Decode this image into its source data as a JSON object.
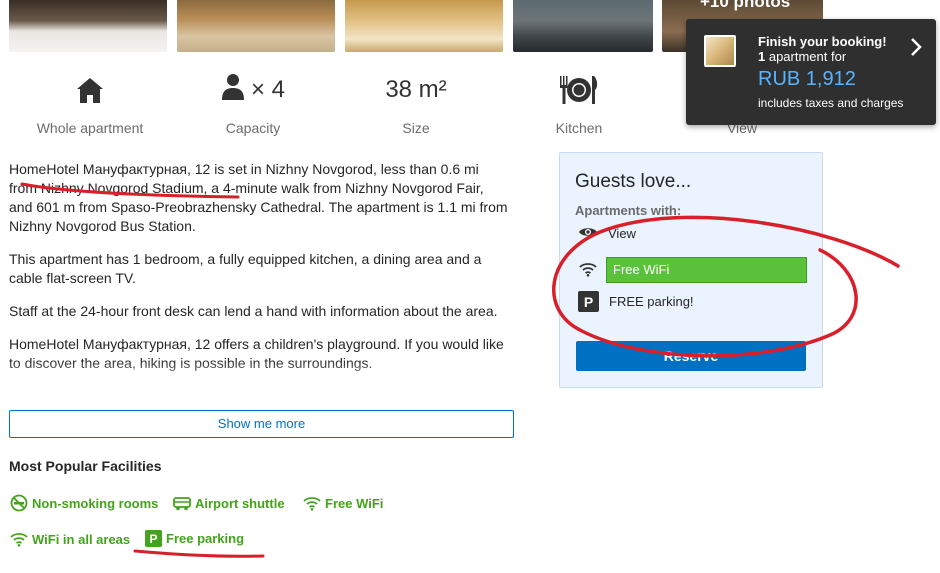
{
  "photos": {
    "more_label": "+10 photos"
  },
  "features": [
    {
      "icon": "house-icon",
      "label": "Whole apartment"
    },
    {
      "icon": "person-icon",
      "value": "× 4",
      "label": "Capacity"
    },
    {
      "value": "38 m²",
      "label": "Size"
    },
    {
      "icon": "fork-plate-knife-icon",
      "label": "Kitchen"
    },
    {
      "icon": "eye-icon",
      "label": "View"
    }
  ],
  "description": [
    "HomeHotel Мануфактурная, 12 is set in Nizhny Novgorod, less than 0.6 mi from Nizhny Novgorod Stadium, a 4-minute walk from Nizhny Novgorod Fair, and 601 m from Spaso-Preobrazhensky Cathedral. The apartment is 1.1 mi from Nizhny Novgorod Bus Station.",
    "This apartment has 1 bedroom, a fully equipped kitchen, a dining area and a cable flat-screen TV.",
    "Staff at the 24-hour front desk can lend a hand with information about the area.",
    "HomeHotel Мануфактурная, 12 offers a children's playground. If you would like to discover the area, hiking is possible in the surroundings."
  ],
  "show_more_label": "Show me more",
  "popular_facilities": {
    "title": "Most Popular Facilities",
    "items": [
      {
        "icon": "no-smoking-icon",
        "label": "Non-smoking rooms"
      },
      {
        "icon": "shuttle-icon",
        "label": "Airport shuttle"
      },
      {
        "icon": "wifi-icon",
        "label": "Free WiFi"
      },
      {
        "icon": "wifi-icon",
        "label": "WiFi in all areas"
      },
      {
        "icon": "parking-icon",
        "label": "Free parking"
      }
    ]
  },
  "guests_love": {
    "title": "Guests love...",
    "subtitle": "Apartments with:",
    "items": [
      {
        "icon": "eye-icon",
        "label": "View"
      },
      {
        "icon": "wifi-icon",
        "label": "Free WiFi"
      },
      {
        "icon": "parking-icon",
        "label": "FREE parking!"
      }
    ],
    "reserve_label": "Reserve"
  },
  "booking_popup": {
    "title": "Finish your booking!",
    "count": "1",
    "line2_rest": " apartment for",
    "price": "RUB 1,912",
    "tax_note": "includes taxes and charges"
  },
  "colors": {
    "accent_blue": "#0071c2",
    "facility_green": "#43a31c",
    "wifi_highlight_green": "#5ac13b",
    "price_blue": "#5ab3ff",
    "annotation_red": "#d9202a"
  }
}
